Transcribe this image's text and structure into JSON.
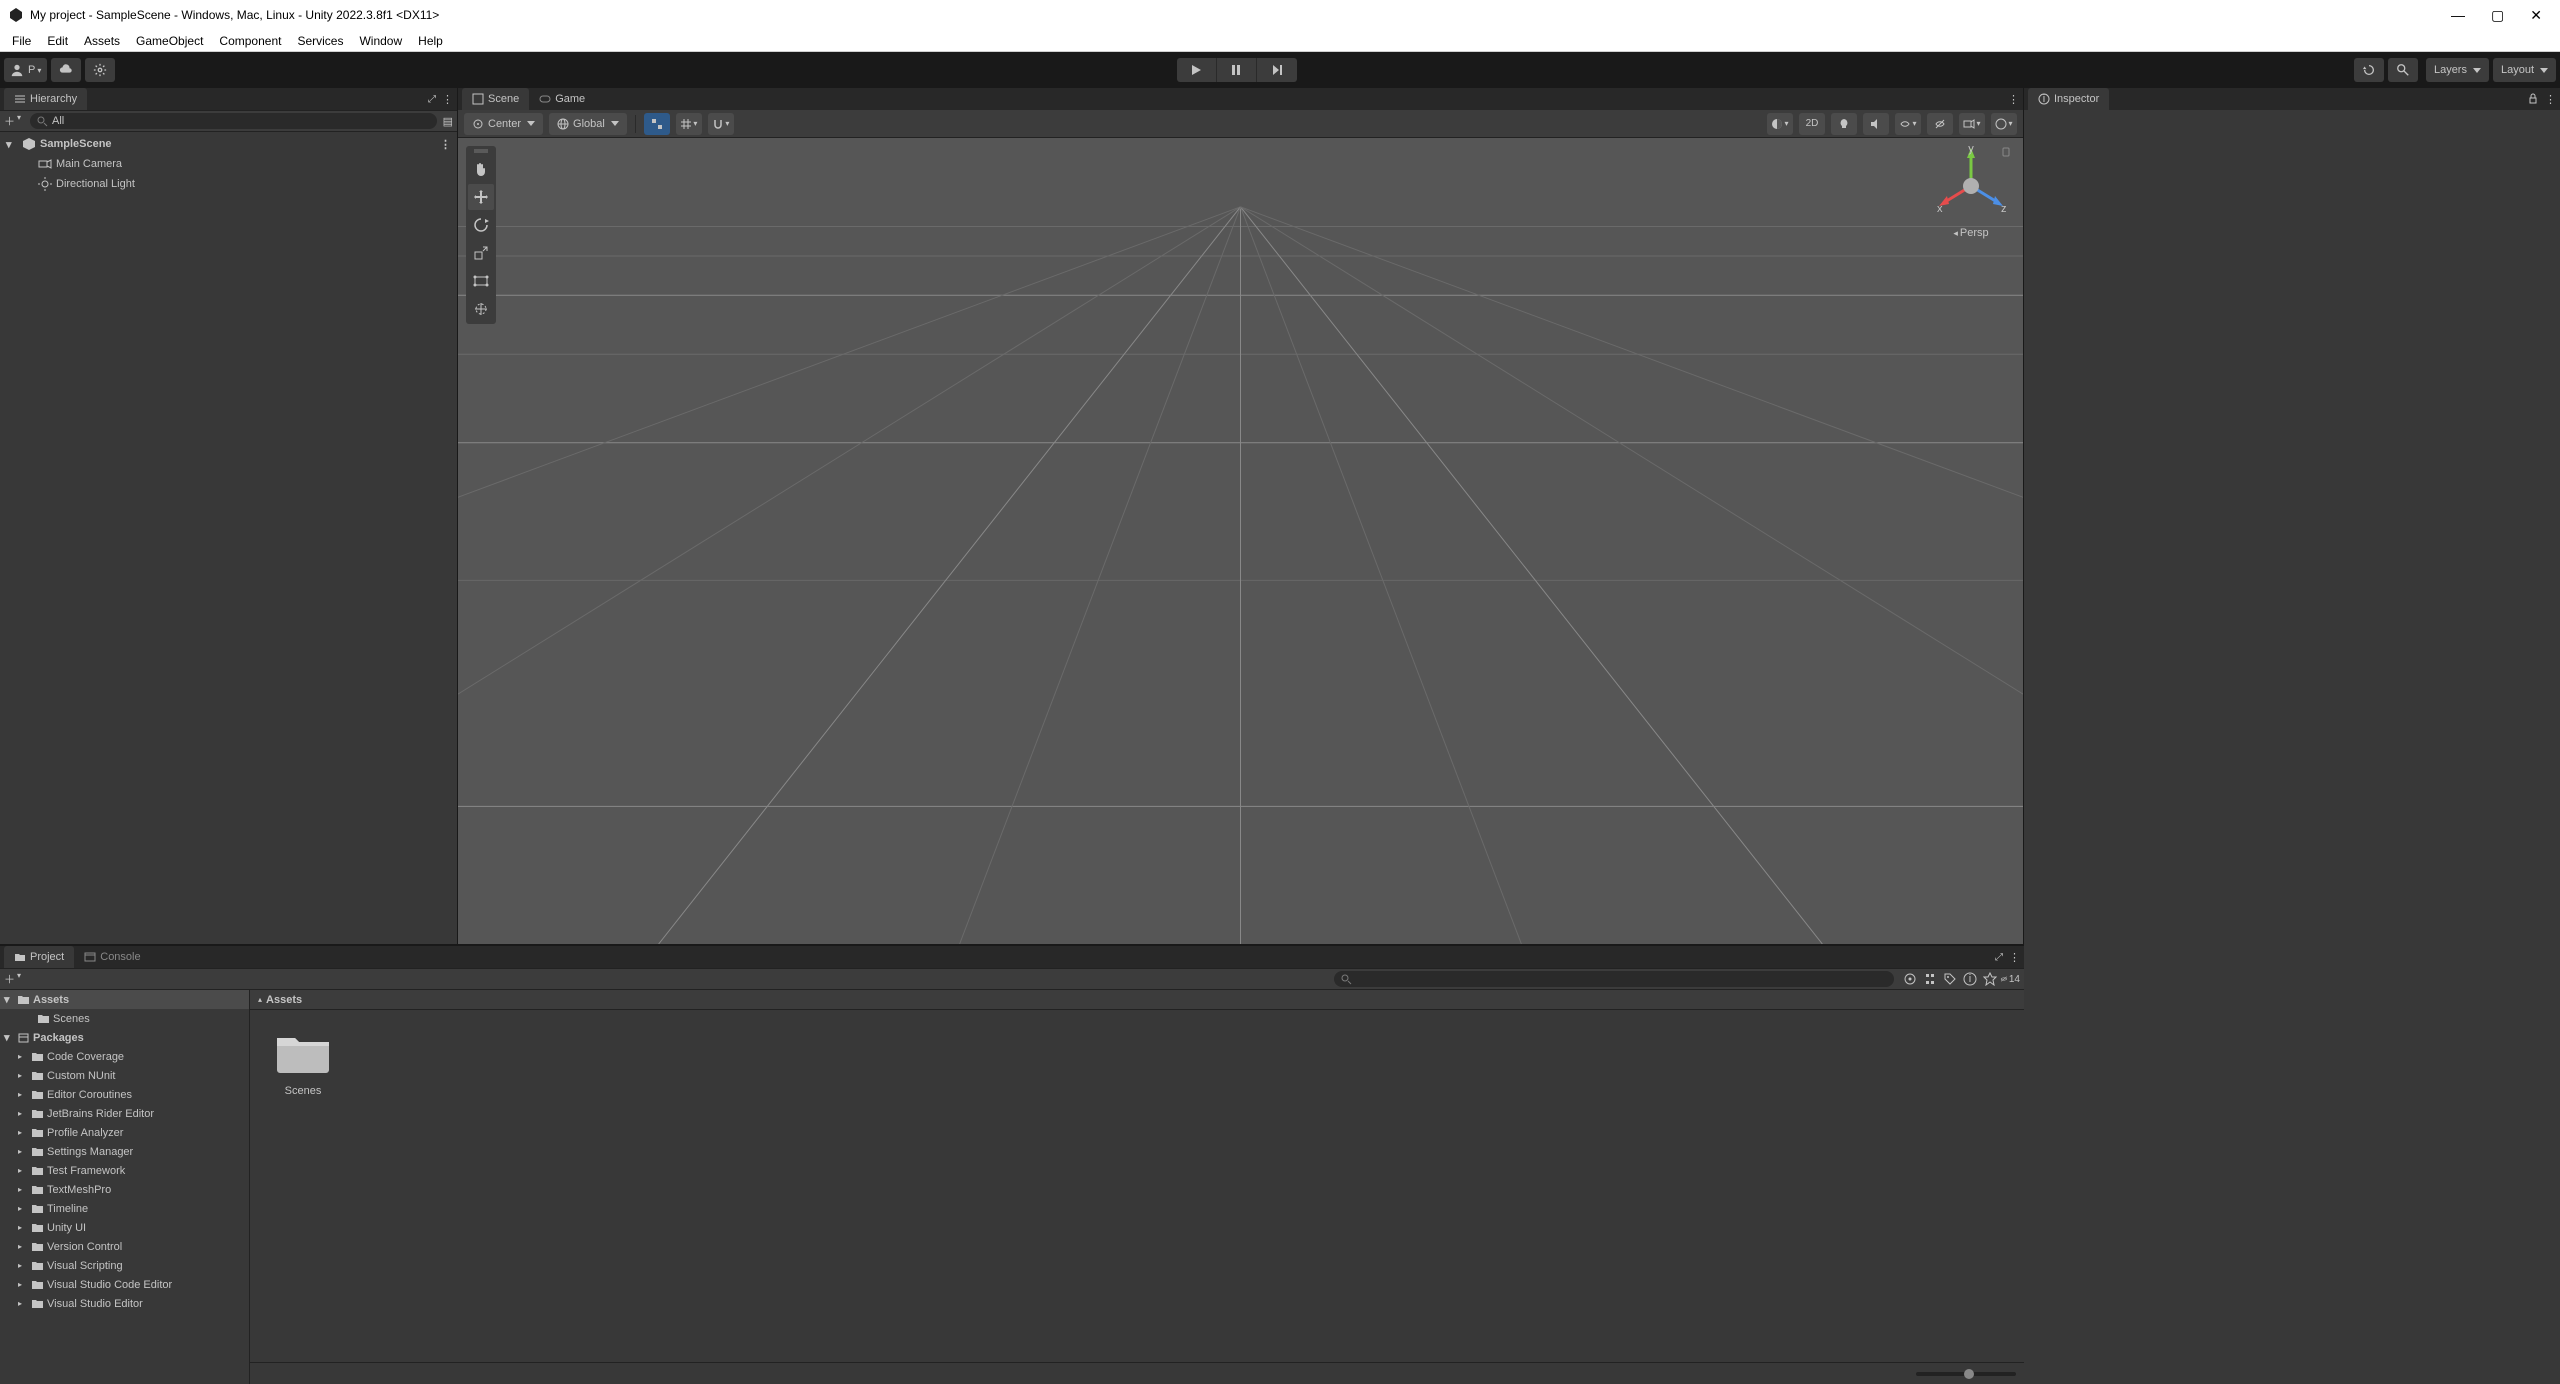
{
  "titlebar": {
    "title": "My project - SampleScene - Windows, Mac, Linux - Unity 2022.3.8f1 <DX11>"
  },
  "menu": [
    "File",
    "Edit",
    "Assets",
    "GameObject",
    "Component",
    "Services",
    "Window",
    "Help"
  ],
  "topbar": {
    "account_letter": "P",
    "layers": "Layers",
    "layout": "Layout"
  },
  "hierarchy": {
    "tab": "Hierarchy",
    "search_placeholder": "All",
    "scene": "SampleScene",
    "items": [
      "Main Camera",
      "Directional Light"
    ]
  },
  "scene": {
    "tab": "Scene",
    "game_tab": "Game",
    "pivot_label": "Center",
    "space_label": "Global",
    "projection": "Persp",
    "axes": {
      "x": "x",
      "y": "y",
      "z": "z"
    },
    "twod": "2D"
  },
  "inspector": {
    "tab": "Inspector"
  },
  "project": {
    "tab": "Project",
    "console_tab": "Console",
    "search_placeholder": "",
    "breadcrumb": "Assets",
    "count_badge": "14",
    "tree": {
      "root": "Assets",
      "root_child": "Scenes",
      "packages": "Packages",
      "package_list": [
        "Code Coverage",
        "Custom NUnit",
        "Editor Coroutines",
        "JetBrains Rider Editor",
        "Profile Analyzer",
        "Settings Manager",
        "Test Framework",
        "TextMeshPro",
        "Timeline",
        "Unity UI",
        "Version Control",
        "Visual Scripting",
        "Visual Studio Code Editor",
        "Visual Studio Editor"
      ]
    },
    "grid_item": "Scenes"
  }
}
